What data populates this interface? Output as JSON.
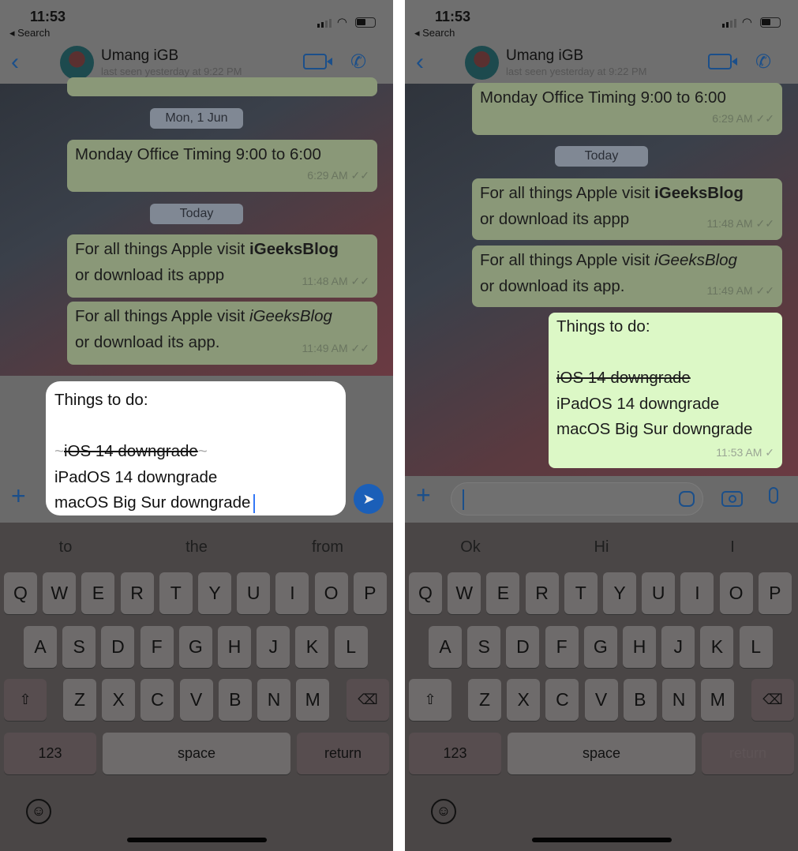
{
  "colors": {
    "accent": "#1b4f8a",
    "sent_bubble": "#dcf8c6"
  },
  "phones": [
    {
      "status": {
        "time": "11:53",
        "back": "◂ Search"
      },
      "header": {
        "name": "Umang iGB",
        "last_seen": "last seen yesterday at 9:22 PM"
      },
      "chips": [
        "Mon, 1 Jun",
        "Today"
      ],
      "messages": [
        {
          "text": "Monday Office Timing 9:00 to 6:00",
          "time": "6:29 AM ✓✓"
        },
        {
          "pre": "For all things Apple visit ",
          "em": "iGeeksBlog",
          "post": "or download its appp",
          "time": "11:48 AM ✓✓"
        },
        {
          "pre": "For all things Apple visit ",
          "em": "iGeeksBlog",
          "post": "or download its app.",
          "time": "11:49 AM ✓✓"
        }
      ],
      "editor": {
        "line1": "Things to do:",
        "strike_mark": "~",
        "strike": "iOS 14 downgrade",
        "line3": "iPadOS 14 downgrade",
        "line4": "macOS Big Sur downgrade"
      },
      "suggestions": [
        "to",
        "the",
        "from"
      ]
    },
    {
      "status": {
        "time": "11:53",
        "back": "◂ Search"
      },
      "header": {
        "name": "Umang iGB",
        "last_seen": "last seen yesterday at 9:22 PM"
      },
      "chips": [
        "Today"
      ],
      "messages": [
        {
          "text": "Monday Office Timing 9:00 to 6:00",
          "time": "6:29 AM ✓✓"
        },
        {
          "pre": "For all things Apple visit ",
          "em": "iGeeksBlog",
          "post": "or download its appp",
          "time": "11:48 AM ✓✓"
        },
        {
          "pre": "For all things Apple visit ",
          "em": "iGeeksBlog",
          "post": "or download its app.",
          "time": "11:49 AM ✓✓"
        },
        {
          "line1": "Things to do:",
          "strike": "iOS 14 downgrade",
          "line3": "iPadOS 14 downgrade",
          "line4": "macOS Big Sur downgrade",
          "time": "11:53 AM ✓"
        }
      ],
      "suggestions": [
        "Ok",
        "Hi",
        "I"
      ]
    }
  ],
  "keyboard": {
    "row1": [
      "Q",
      "W",
      "E",
      "R",
      "T",
      "Y",
      "U",
      "I",
      "O",
      "P"
    ],
    "row2": [
      "A",
      "S",
      "D",
      "F",
      "G",
      "H",
      "J",
      "K",
      "L"
    ],
    "row3": [
      "Z",
      "X",
      "C",
      "V",
      "B",
      "N",
      "M"
    ],
    "shift": "⇧",
    "delete": "⌫",
    "numbers": "123",
    "space": "space",
    "return": "return",
    "emoji": "☺"
  }
}
